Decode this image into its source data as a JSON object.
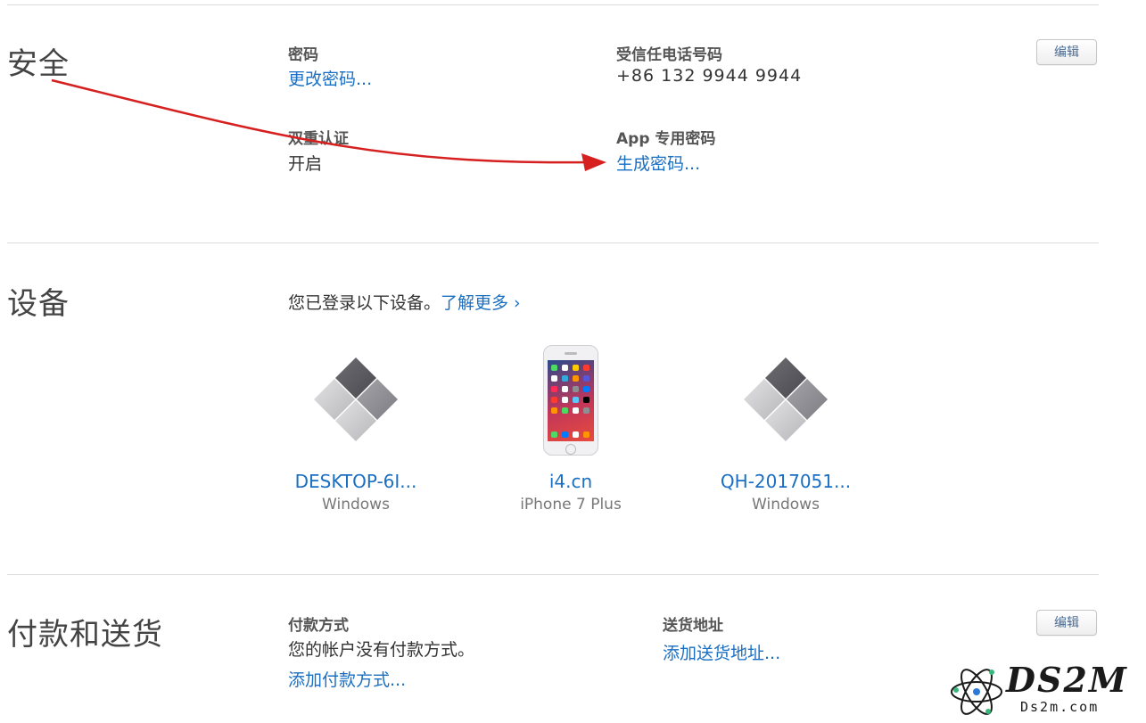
{
  "security": {
    "title": "安全",
    "password_label": "密码",
    "password_link": "更改密码...",
    "trusted_phone_label": "受信任电话号码",
    "trusted_phone_value": "+86 132 9944 9944",
    "two_factor_label": "双重认证",
    "two_factor_value": "开启",
    "app_password_label": "App 专用密码",
    "app_password_link": "生成密码...",
    "edit_label": "编辑"
  },
  "devices": {
    "title": "设备",
    "intro": "您已登录以下设备。",
    "learn_more": "了解更多 ›",
    "items": [
      {
        "name": "DESKTOP-6I...",
        "type": "Windows",
        "icon": "windows-icon"
      },
      {
        "name": "i4.cn",
        "type": "iPhone 7 Plus",
        "icon": "iphone-icon"
      },
      {
        "name": "QH-2017051...",
        "type": "Windows",
        "icon": "windows-icon"
      }
    ]
  },
  "payment": {
    "title": "付款和送货",
    "method_label": "付款方式",
    "method_value": "您的帐户没有付款方式。",
    "method_link": "添加付款方式...",
    "shipping_label": "送货地址",
    "shipping_link": "添加送货地址...",
    "edit_label": "编辑"
  },
  "watermark": {
    "logo_text": "DS2M",
    "site_text": "Ds2m.com"
  },
  "colors": {
    "link": "#1a6fc2",
    "annotation_arrow": "#d62020"
  }
}
